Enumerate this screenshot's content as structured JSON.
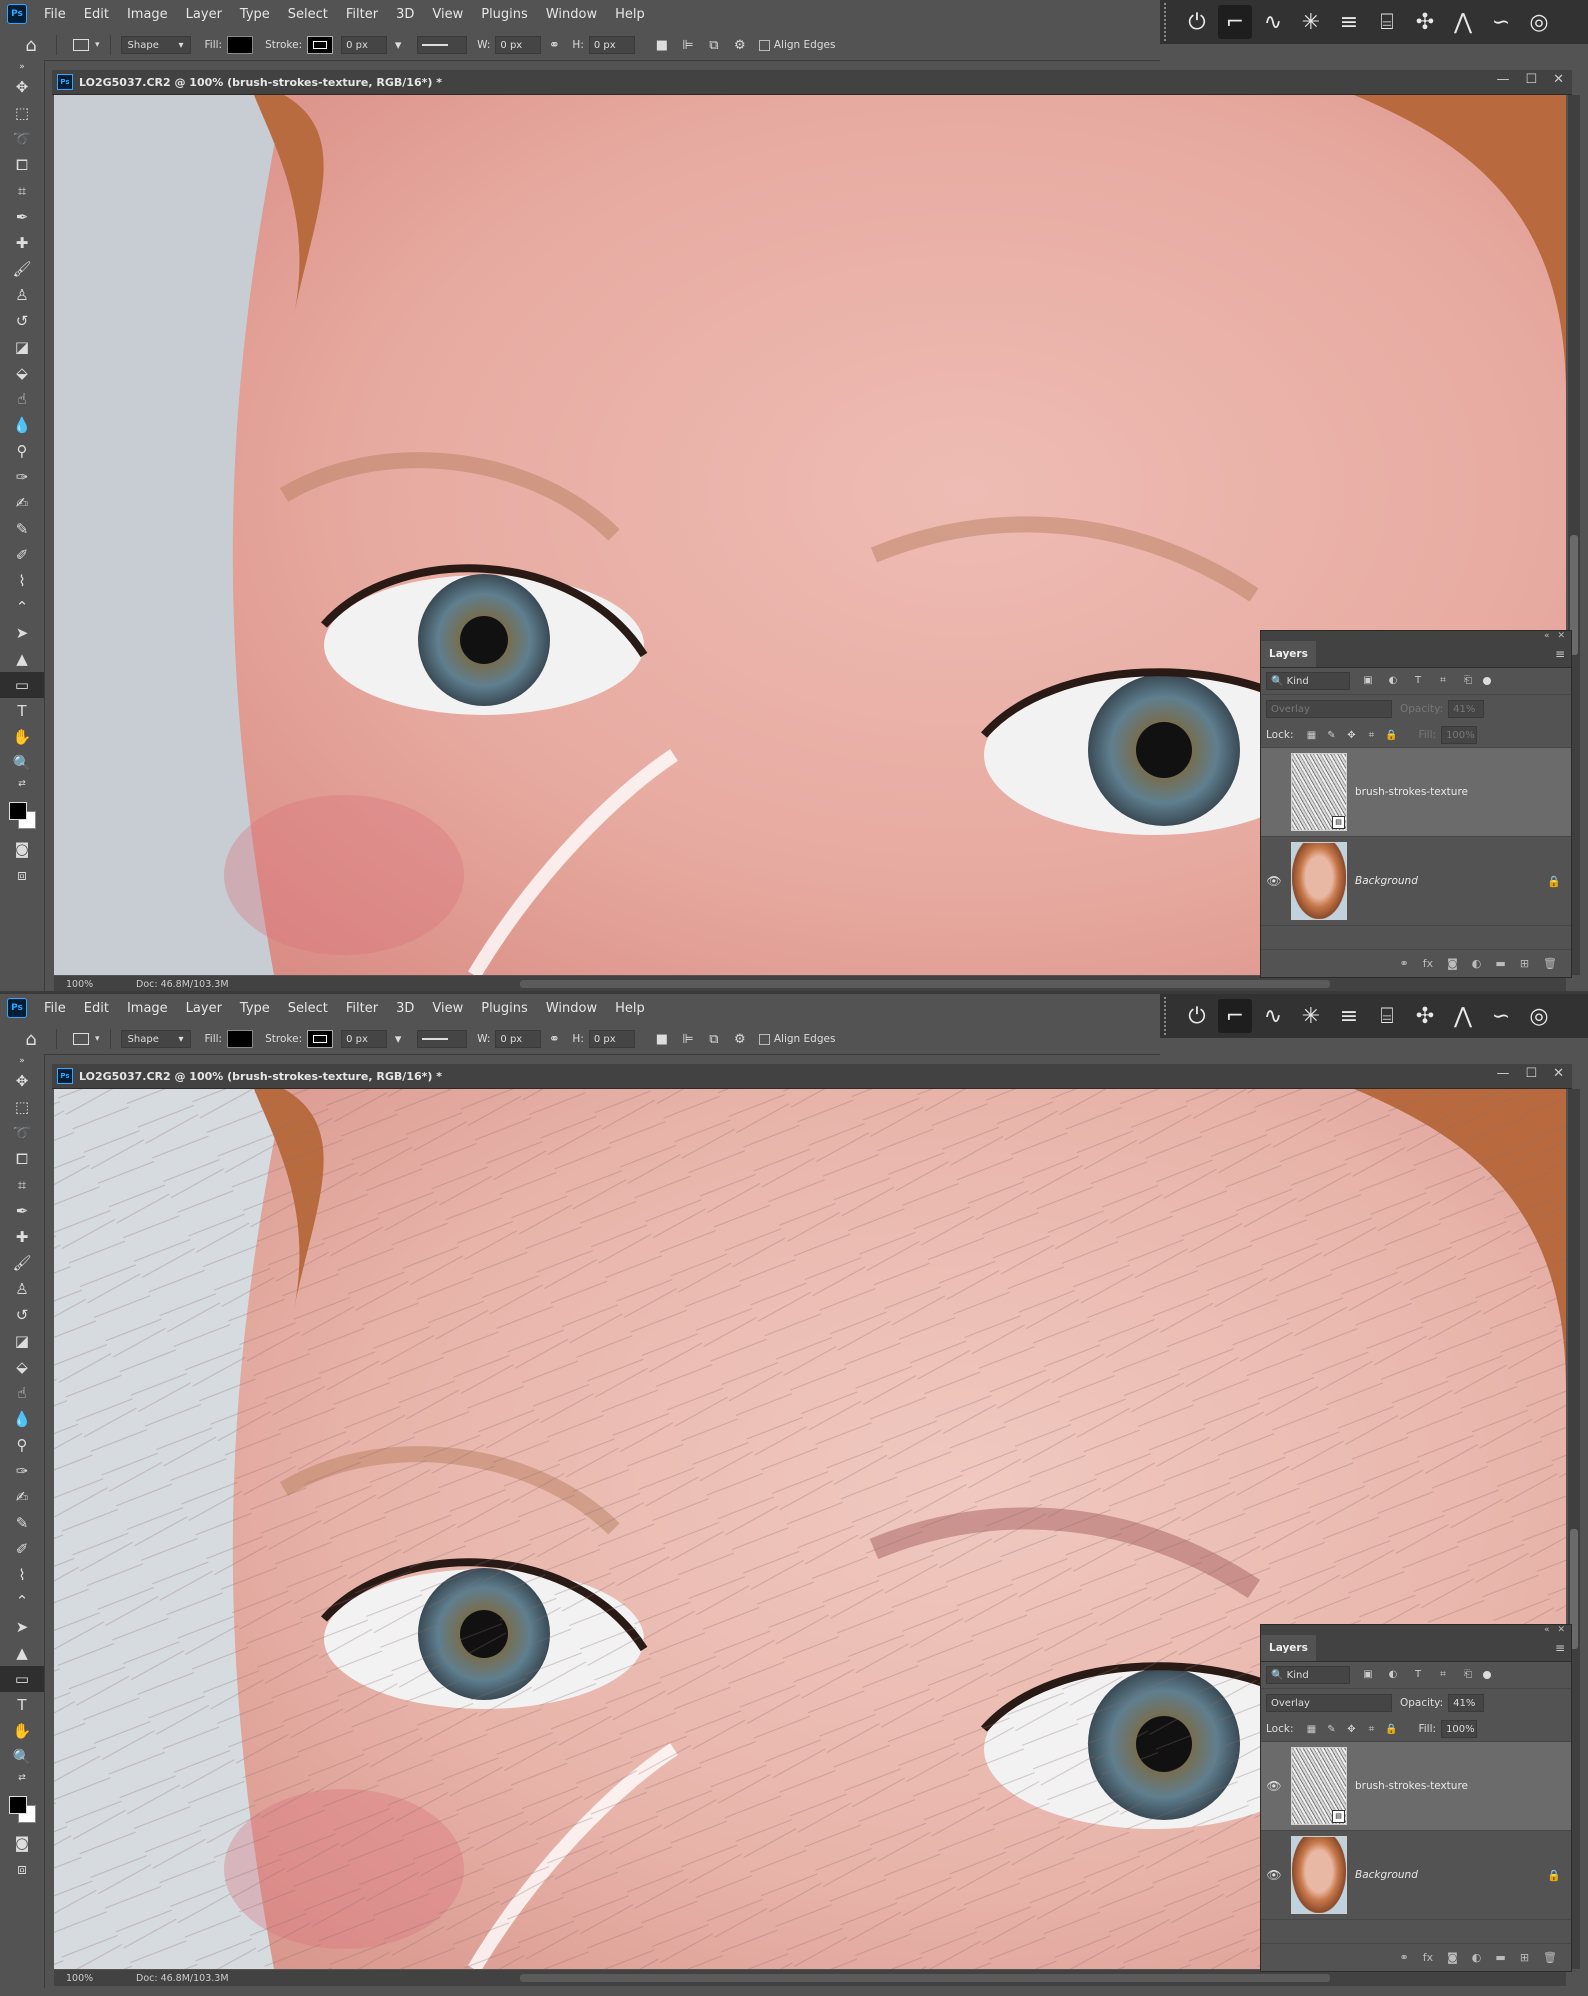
{
  "menu": {
    "app_icon": "Ps",
    "items": [
      "File",
      "Edit",
      "Image",
      "Layer",
      "Type",
      "Select",
      "Filter",
      "3D",
      "View",
      "Plugins",
      "Window",
      "Help"
    ]
  },
  "options": {
    "tool_mode": "Shape",
    "fill_label": "Fill:",
    "stroke_label": "Stroke:",
    "stroke_width": "0 px",
    "w_label": "W:",
    "w_value": "0 px",
    "h_label": "H:",
    "h_value": "0 px",
    "align_edges": "Align Edges"
  },
  "document": {
    "title": "LO2G5037.CR2 @ 100% (brush-strokes-texture, RGB/16*) *",
    "zoom": "100%",
    "doc_size": "Doc: 46.8M/103.3M"
  },
  "layers_panel": {
    "tab": "Layers",
    "kind": "Kind",
    "opacity_label": "Opacity:",
    "fill_label": "Fill:",
    "lock_label": "Lock:",
    "layers": [
      {
        "name": "brush-strokes-texture"
      },
      {
        "name": "Background"
      }
    ]
  },
  "states": {
    "top": {
      "blend_mode": "Overlay",
      "opacity": "41%",
      "fill": "100%",
      "texture_visible": false
    },
    "bottom": {
      "blend_mode": "Overlay",
      "opacity": "41%",
      "fill": "100%",
      "texture_visible": true
    }
  },
  "colors": {
    "accent": "#31a8ff",
    "panel_bg": "#535353",
    "dark_bg": "#424242",
    "foreground": "#000000",
    "background": "#ffffff"
  },
  "icons": {
    "toolbar": [
      "move-icon",
      "marquee-icon",
      "lasso-icon",
      "object-select-icon",
      "crop-icon",
      "eyedropper-icon",
      "healing-brush-icon",
      "brush-icon",
      "clone-stamp-icon",
      "history-brush-icon",
      "eraser-icon",
      "paint-bucket-icon",
      "smudge-icon",
      "dodge-icon",
      "burn-icon",
      "pen-icon",
      "freeform-pen-icon",
      "curvature-pen-icon",
      "add-anchor-icon",
      "path-select-icon",
      "direct-select-icon",
      "pointer-icon",
      "rectangle-icon",
      "type-icon",
      "hand-icon",
      "zoom-icon"
    ],
    "plugins": [
      "power-icon",
      "path-tool-icon",
      "curve-icon",
      "sparkle-icon",
      "lines-icon",
      "frame-icon",
      "cross-icon",
      "peak-icon",
      "wave-icon",
      "spiral-icon"
    ]
  }
}
